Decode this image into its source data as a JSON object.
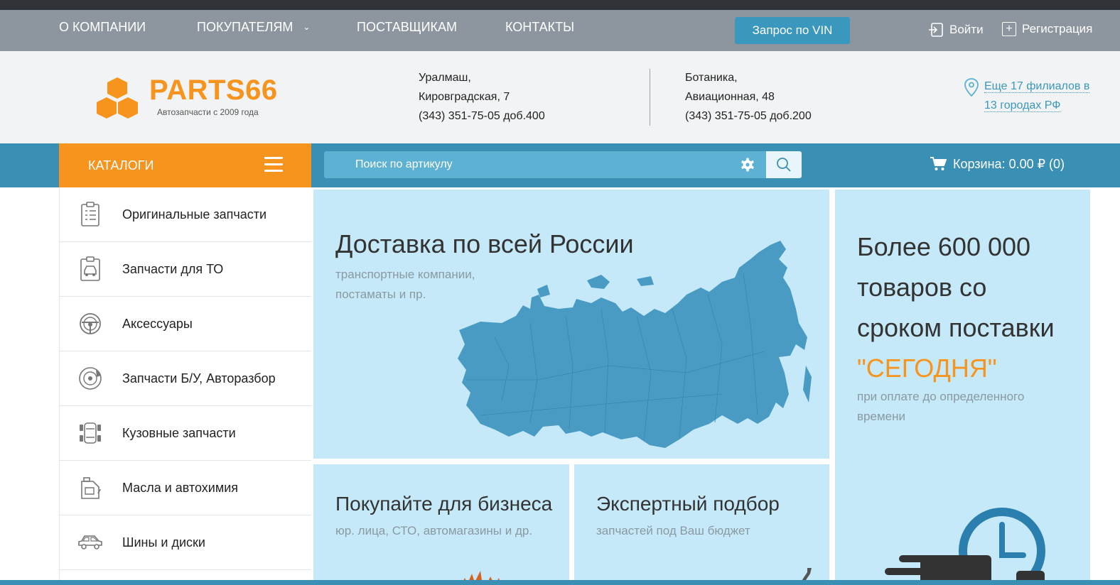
{
  "topnav": {
    "items": [
      {
        "label": "О КОМПАНИИ"
      },
      {
        "label": "ПОКУПАТЕЛЯМ",
        "caret": "⌄"
      },
      {
        "label": "ПОСТАВЩИКАМ"
      },
      {
        "label": "КОНТАКТЫ"
      }
    ],
    "vin_button": "Запрос по VIN",
    "login": "Войти",
    "register": "Регистрация",
    "register_icon": "+"
  },
  "header": {
    "logo": {
      "name": "PARTS66",
      "tagline": "Автозапчасти с 2009 года"
    },
    "branch1": {
      "line1": "Уралмаш,",
      "line2": "Кировградская, 7",
      "phone": "(343) 351-75-05 доб.400"
    },
    "branch2": {
      "line1": "Ботаника,",
      "line2": "Авиационная, 48",
      "phone": "(343) 351-75-05 доб.200"
    },
    "more_branches": {
      "line1": "Еще 17 филиалов в",
      "line2": "13 городах РФ"
    }
  },
  "bar": {
    "catalog_label": "КАТАЛОГИ",
    "search_placeholder": "Поиск по артикулу",
    "cart_label": "Корзина: 0.00 ₽  (0)"
  },
  "sidebar": {
    "items": [
      {
        "label": "Оригинальные запчасти",
        "icon": "clipboard-list-icon"
      },
      {
        "label": "Запчасти для ТО",
        "icon": "maintenance-icon"
      },
      {
        "label": "Аксессуары",
        "icon": "steering-wheel-icon"
      },
      {
        "label": "Запчасти Б/У, Авторазбор",
        "icon": "brake-disc-icon"
      },
      {
        "label": "Кузовные запчасти",
        "icon": "car-body-icon"
      },
      {
        "label": "Масла и автохимия",
        "icon": "oil-canister-icon"
      },
      {
        "label": "Шины и диски",
        "icon": "car-icon"
      }
    ]
  },
  "promos": {
    "delivery": {
      "title": "Доставка по всей России",
      "sub1": "транспортные компании,",
      "sub2": "постаматы и пр."
    },
    "stock": {
      "line1": "Более 600 000",
      "line2": "товаров со",
      "line3": "сроком поставки",
      "highlight": "\"СЕГОДНЯ\"",
      "sub1": "при оплате до определенного",
      "sub2": "времени"
    },
    "business": {
      "title": "Покупайте для бизнеса",
      "sub": "юр. лица, СТО, автомагазины и др."
    },
    "expert": {
      "title": "Экспертный подбор",
      "sub": "запчастей под Ваш бюджет"
    }
  },
  "colors": {
    "accent": "#f7941d",
    "blue": "#3a8fb4",
    "panel": "#c5e9f8",
    "topbar": "#8d969f"
  }
}
